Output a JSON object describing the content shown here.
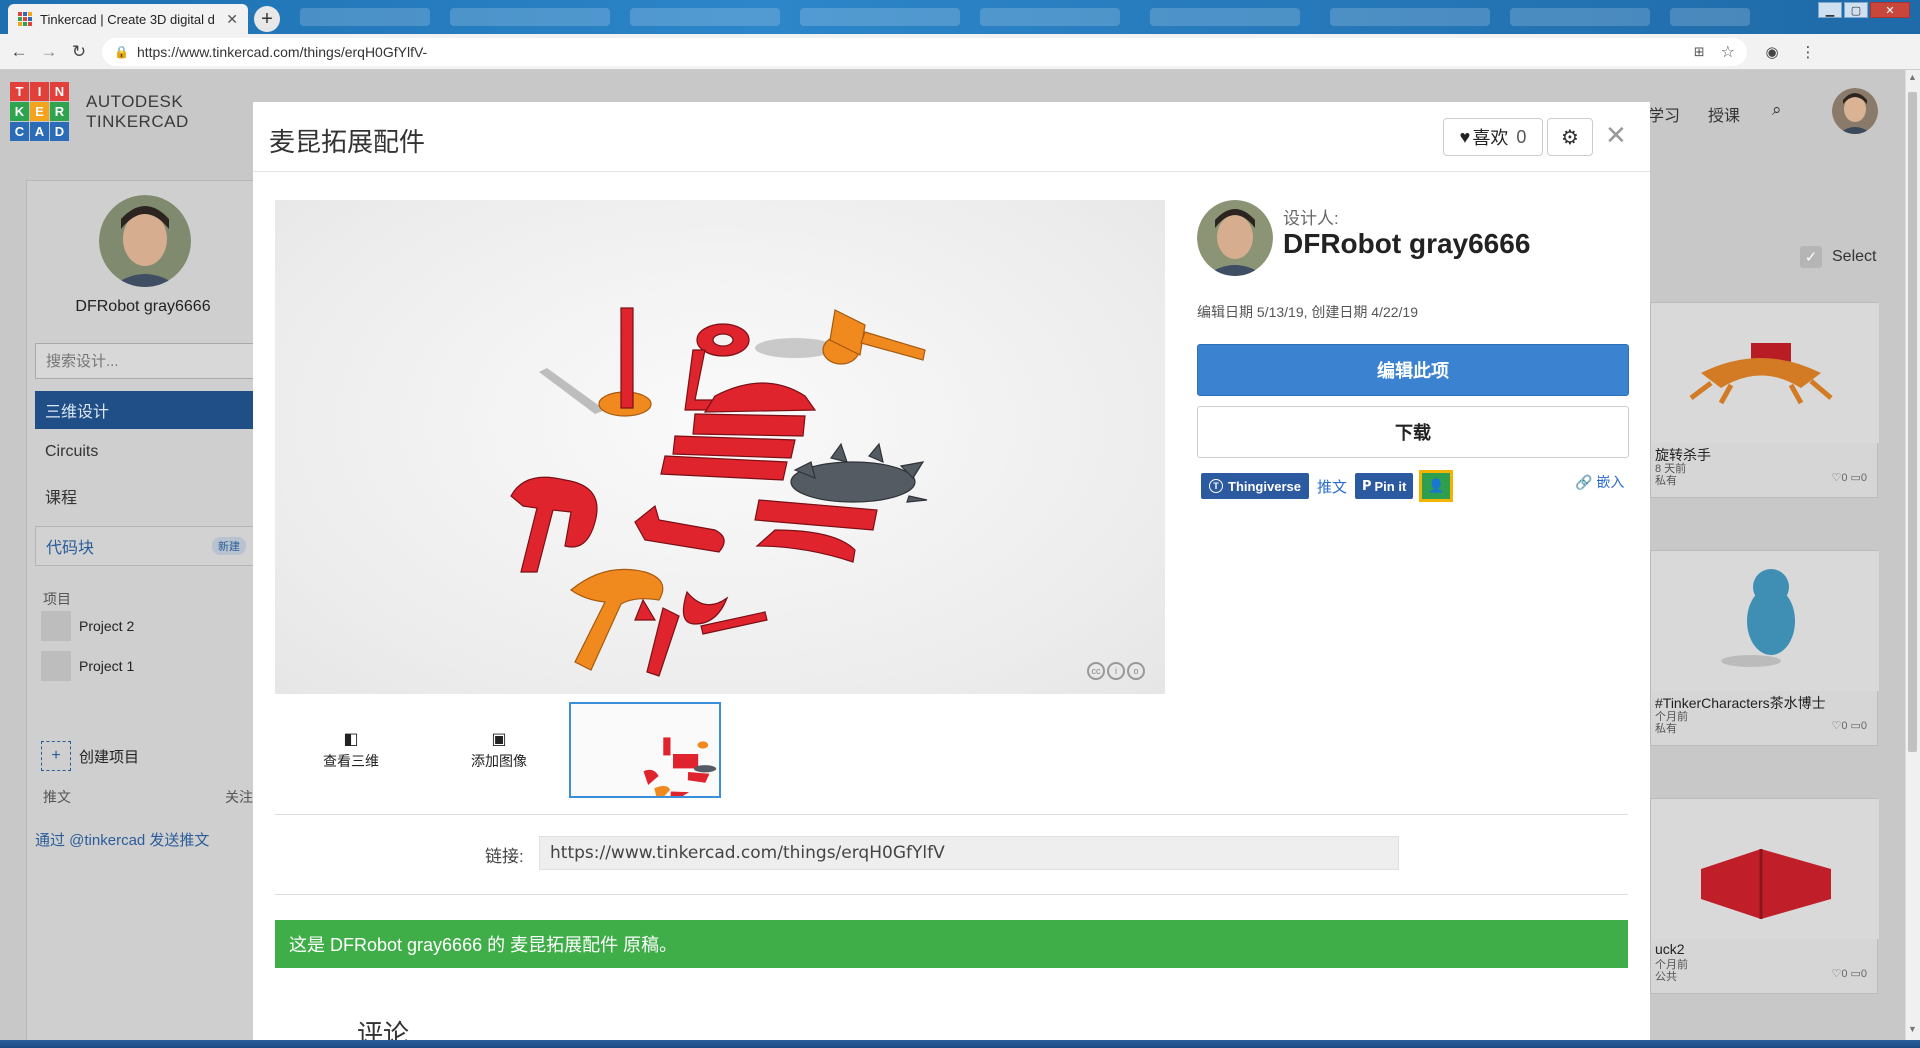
{
  "browser": {
    "tab_title": "Tinkercad | Create 3D digital d",
    "url": "https://www.tinkercad.com/things/erqH0GfYlfV-"
  },
  "header": {
    "logo_letters": [
      "T",
      "I",
      "N",
      "K",
      "E",
      "R",
      "C",
      "A",
      "D"
    ],
    "brand_line1": "AUTODESK",
    "brand_line2": "TINKERCAD",
    "nav_learn": "学习",
    "nav_teach": "授课"
  },
  "sidebar": {
    "user_name": "DFRobot gray6666",
    "search_placeholder": "搜索设计...",
    "items": [
      "三维设计",
      "Circuits",
      "课程"
    ],
    "codeblocks_label": "代码块",
    "codeblocks_badge": "新建",
    "projects_heading": "项目",
    "projects": [
      "Project 2",
      "Project 1"
    ],
    "create_project": "创建项目",
    "tweets_label": "推文",
    "follow_label": "关注",
    "tweet_link": "通过 @tinkercad 发送推文"
  },
  "gallery": {
    "select_label": "Select",
    "cards": [
      {
        "title": "旋转杀手",
        "sub1": "8 天前",
        "sub2": "私有",
        "stats": "♡0 ▭0"
      },
      {
        "title": "#TinkerCharacters茶水博士",
        "sub1": "个月前",
        "sub2": "私有",
        "stats": "♡0 ▭0"
      },
      {
        "title": "uck2",
        "sub1": "个月前",
        "sub2": "公共",
        "stats": "♡0 ▭0"
      }
    ]
  },
  "modal": {
    "title": "麦昆拓展配件",
    "like_label": "喜欢",
    "like_count": "0",
    "designer_label": "设计人:",
    "designer_name": "DFRobot gray6666",
    "dates": "编辑日期 5/13/19, 创建日期 4/22/19",
    "edit_button": "编辑此项",
    "download_button": "下载",
    "thingiverse_label": "Thingiverse",
    "tweet_label": "推文",
    "pin_label": "Pin it",
    "embed_label": "嵌入",
    "view_3d_label": "查看三维",
    "add_image_label": "添加图像",
    "link_label": "链接:",
    "link_value": "https://www.tinkercad.com/things/erqH0GfYlfV",
    "original_banner": "这是 DFRobot gray6666 的 麦昆拓展配件 原稿。",
    "comments_heading": "评论"
  },
  "colors": {
    "accent_blue": "#3b82d0",
    "banner_green": "#3fae49",
    "part_red": "#e0242e",
    "part_orange": "#f0891e",
    "part_gray": "#555b62"
  }
}
